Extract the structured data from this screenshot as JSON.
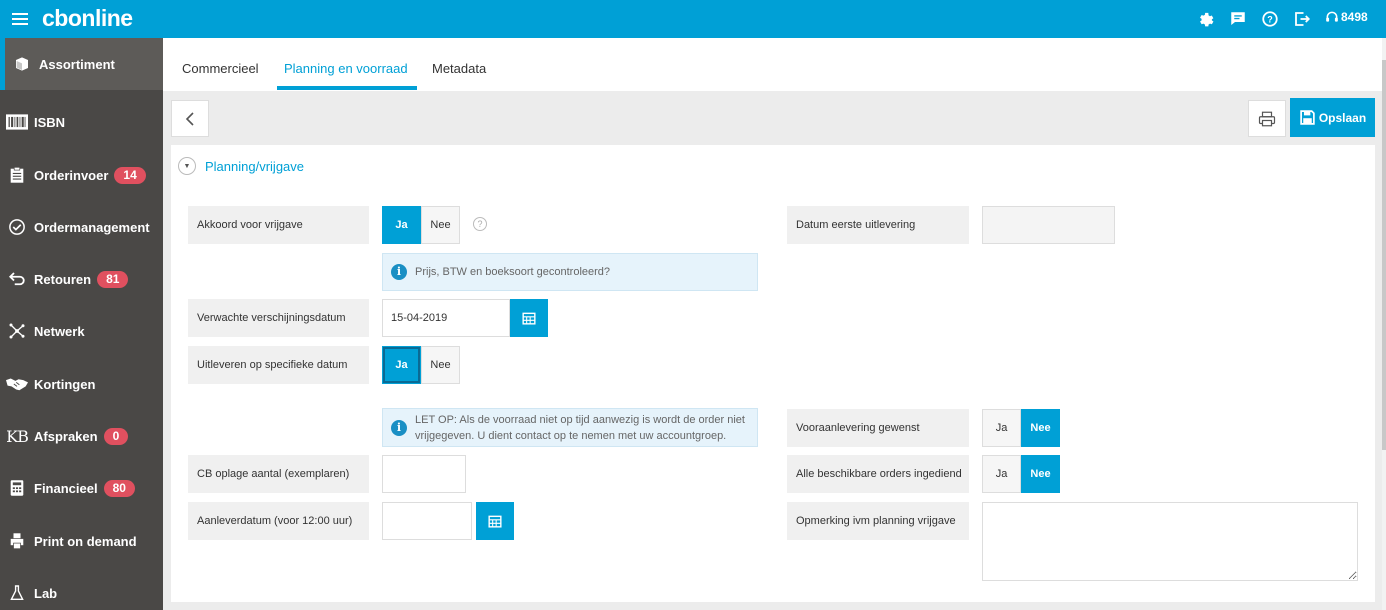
{
  "app": {
    "brand": "cbonline",
    "user_id": "8498"
  },
  "sidebar": {
    "items": [
      {
        "label": "Assortiment",
        "badge": null
      },
      {
        "label": "ISBN",
        "badge": null
      },
      {
        "label": "Orderinvoer",
        "badge": "14"
      },
      {
        "label": "Ordermanagement",
        "badge": null
      },
      {
        "label": "Retouren",
        "badge": "81"
      },
      {
        "label": "Netwerk",
        "badge": null
      },
      {
        "label": "Kortingen",
        "badge": null
      },
      {
        "label": "Afspraken",
        "badge": "0"
      },
      {
        "label": "Financieel",
        "badge": "80"
      },
      {
        "label": "Print on demand",
        "badge": null
      },
      {
        "label": "Lab",
        "badge": null
      }
    ]
  },
  "tabs": [
    {
      "label": "Commercieel"
    },
    {
      "label": "Planning en voorraad"
    },
    {
      "label": "Metadata"
    }
  ],
  "toolbar": {
    "save_label": "Opslaan"
  },
  "section": {
    "title": "Planning/vrijgave"
  },
  "form": {
    "akkoord": {
      "label": "Akkoord voor vrijgave",
      "yes": "Ja",
      "no": "Nee",
      "value": "Ja"
    },
    "akkoord_info": "Prijs, BTW en boeksoort gecontroleerd?",
    "verschijningsdatum": {
      "label": "Verwachte verschijningsdatum",
      "value": "15-04-2019"
    },
    "specifieke_datum": {
      "label": "Uitleveren op specifieke datum",
      "yes": "Ja",
      "no": "Nee",
      "value": "Ja"
    },
    "letop_info": "LET OP: Als de voorraad niet op tijd aanwezig is wordt de order niet vrijgegeven. U dient contact op te nemen met uw accountgroep.",
    "oplage": {
      "label": "CB oplage aantal (exemplaren)",
      "value": ""
    },
    "aanleverdatum": {
      "label": "Aanleverdatum (voor 12:00 uur)",
      "value": ""
    },
    "eerste_uitlevering": {
      "label": "Datum eerste uitlevering",
      "value": ""
    },
    "vooraanlevering": {
      "label": "Vooraanlevering gewenst",
      "yes": "Ja",
      "no": "Nee",
      "value": "Nee"
    },
    "orders_ingediend": {
      "label": "Alle beschikbare orders ingediend",
      "yes": "Ja",
      "no": "Nee",
      "value": "Nee"
    },
    "opmerking": {
      "label": "Opmerking ivm planning vrijgave",
      "value": ""
    }
  },
  "colors": {
    "accent": "#00a0d6",
    "sidebar_bg": "#4a4846",
    "badge": "#e0505f"
  }
}
